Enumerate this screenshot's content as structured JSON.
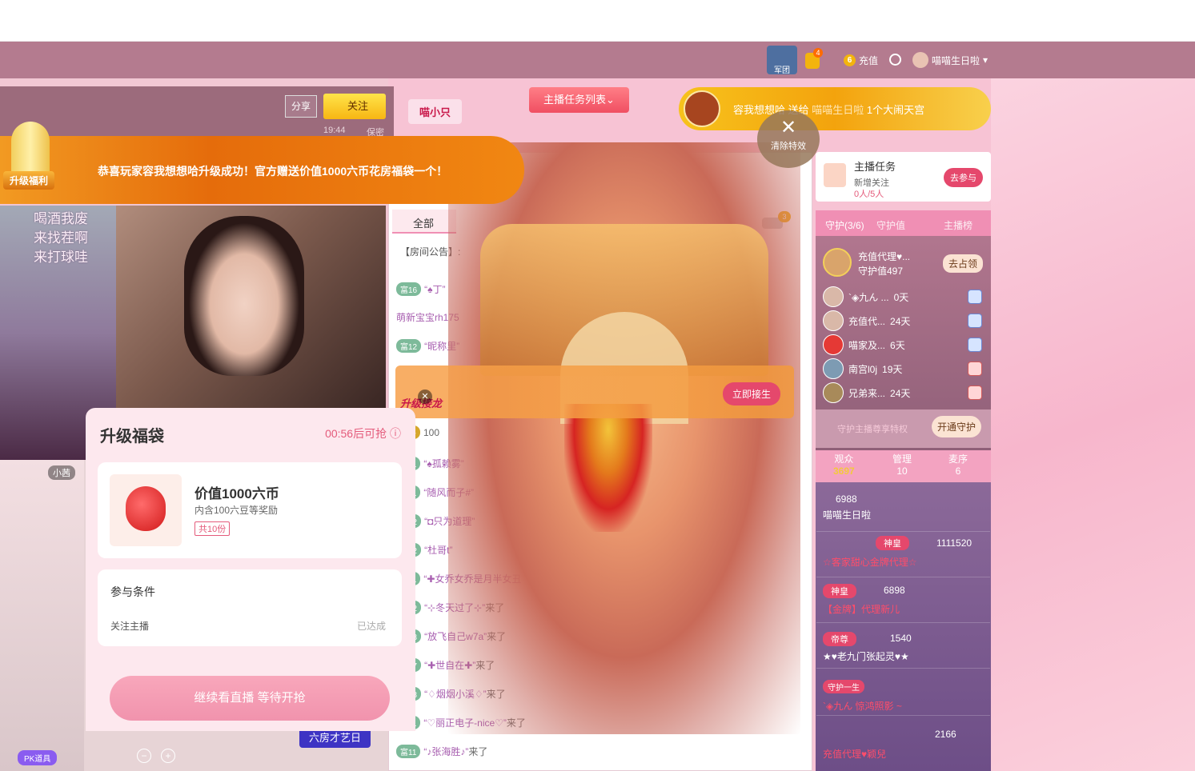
{
  "topbar": {
    "legion_label": "军团",
    "bag_badge": "4",
    "coin_icon_text": "6",
    "recharge_label": "充值",
    "username": "喵喵生日啦"
  },
  "room": {
    "share_label": "分享",
    "follow_label": "关注",
    "time": "19:44",
    "meta2": "保密",
    "anchor_tag": "喵小只"
  },
  "task_list_label": "主播任务列表",
  "gift_banner": {
    "sender": "容我想想哈",
    "action": "送给",
    "receiver": "喵喵生日啦",
    "gift": "1个大闹天宫"
  },
  "clear_effects_label": "清除特效",
  "upgrade_banner": {
    "tag": "升级福利",
    "text": "恭喜玩家容我想想哈升级成功！官方赠送价值1000六币花房福袋一个！"
  },
  "video": {
    "overlay_text": [
      "喝酒我废",
      "来找茬啊",
      "来打球哇"
    ],
    "small_anchor": "小茜",
    "pk_label": "PK道具",
    "room_label": "六房才艺日"
  },
  "popup": {
    "title": "升级福袋",
    "countdown": "00:56后可抢",
    "prize_name": "价值1000六币",
    "prize_desc": "内含100六豆等奖励",
    "prize_count": "共10份",
    "cond_title": "参与条件",
    "cond_item": "关注主播",
    "cond_status": "已达成",
    "wait_button": "继续看直播 等待开抢"
  },
  "chat": {
    "tab_all": "全部",
    "tab_point": "点",
    "car_badge": "3",
    "announcement": "【房间公告】:",
    "lines": [
      {
        "lvl": "富16",
        "nick": "",
        "text": "“♠丁”"
      },
      {
        "lvl": "",
        "nick": "萌新宝宝rh175",
        "text": ""
      },
      {
        "lvl": "富12",
        "nick": "“昵称里”",
        "text": ""
      },
      {
        "lvl": "伯爵",
        "nick": "",
        "text": "100"
      },
      {
        "lvl": "富11",
        "nick": "“♠孤赖雾”",
        "text": ""
      },
      {
        "lvl": "富11",
        "nick": "“随风而子#”",
        "text": ""
      },
      {
        "lvl": "富12",
        "nick": "“◘只为道理”",
        "text": ""
      },
      {
        "lvl": "富12",
        "nick": "“杜哥t”",
        "text": ""
      },
      {
        "lvl": "富11",
        "nick": "“✚女乔女乔是月半女丑",
        "text": ""
      },
      {
        "lvl": "富12",
        "nick": "“⊹冬天过了⊹”",
        "text": "来了"
      },
      {
        "lvl": "富13",
        "nick": "“放飞自己w7a”",
        "text": "来了"
      },
      {
        "lvl": "富17",
        "nick": "“✚世自在✚”",
        "text": "来了"
      },
      {
        "lvl": "富13",
        "nick": "“♢烟烟小溪♢”",
        "text": "来了"
      },
      {
        "lvl": "富11",
        "nick": "“♡丽正电子-nice♡”",
        "text": "来了"
      },
      {
        "lvl": "富11",
        "nick": "“♪张海胜♪”",
        "text": "来了"
      }
    ],
    "dragon_label": "升级接龙",
    "join_label": "立即接生"
  },
  "anchor_task": {
    "title": "主播任务",
    "sub": "新增关注",
    "progress": "0人/5人",
    "join_btn": "去参与"
  },
  "guard": {
    "tab1": "守护(3/6)",
    "tab2": "守护值",
    "tab3": "主播榜",
    "top_name": "充值代理♥...",
    "top_value": "守护值497",
    "top_btn": "去占领",
    "rows": [
      {
        "name": "`◈九ん ...",
        "days": "0天"
      },
      {
        "name": "充值代...",
        "days": "24天"
      },
      {
        "name": "喵家及...",
        "days": "6天"
      },
      {
        "name": "南宫l0j",
        "days": "19天"
      },
      {
        "name": "兄弟来...",
        "days": "24天"
      }
    ],
    "privilege_text": "守护主播尊享特权",
    "open_btn": "开通守护"
  },
  "audience": {
    "tab1": "观众",
    "tab1_count": "3697",
    "tab2": "管理",
    "tab2_count": "10",
    "tab3": "麦序",
    "tab3_count": "6",
    "rows": [
      {
        "badge": "",
        "score": "6988",
        "name": "喵喵生日啦"
      },
      {
        "badge": "神皇",
        "score": "1111520",
        "name": "☆客家甜心金牌代理☆"
      },
      {
        "badge": "神皇",
        "score": "6898",
        "name": "【金牌】代理新儿"
      },
      {
        "badge": "帝尊",
        "score": "1540",
        "name": "★♥老九门张起灵♥★"
      },
      {
        "badge": "守护一生",
        "score": "",
        "name": "`◈九ん 惊鸿照影 ~"
      },
      {
        "badge": "",
        "score": "2166",
        "name": "充值代理♥颖兒"
      }
    ]
  }
}
